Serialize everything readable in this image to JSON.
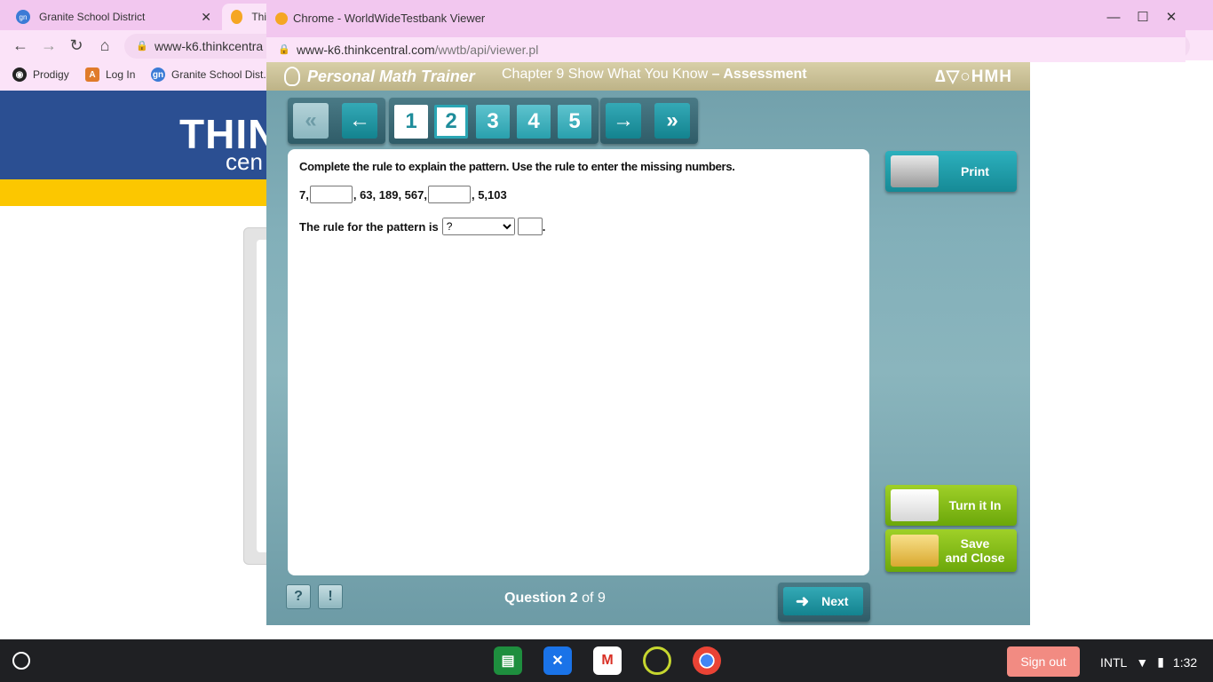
{
  "browser": {
    "tabs": [
      {
        "label": "Granite School District",
        "active": false
      },
      {
        "label": "Thi",
        "active": true
      }
    ],
    "url": "www-k6.thinkcentra",
    "bookmarks": [
      "Prodigy",
      "Log In",
      "Granite School Dist..."
    ],
    "banner_logo_line1": "THIN",
    "banner_logo_line2": "cen"
  },
  "popup": {
    "title": "Chrome - WorldWideTestbank Viewer",
    "url_host": "www-k6.thinkcentral.com",
    "url_path": "/wwtb/api/viewer.pl",
    "buttons": {
      "minimize": "—",
      "maximize": "☐",
      "close": "✕"
    }
  },
  "trainer": {
    "brand": "Personal Math Trainer",
    "chapter_title": "Chapter 9 Show What You Know",
    "chapter_suffix": "– Assessment",
    "publisher": "∆▽○HMH",
    "nav": {
      "first": "«",
      "prev": "←",
      "next": "→",
      "last": "»",
      "questions": [
        "1",
        "2",
        "3",
        "4",
        "5"
      ],
      "current_question": 2
    },
    "question": {
      "instruction": "Complete the rule to explain the pattern. Use the rule to enter the missing numbers.",
      "sequence": [
        "7,",
        ", 63, 189, 567,",
        ", 5,103"
      ],
      "rule_prefix": "The rule for the pattern is",
      "rule_select_value": "?",
      "rule_suffix": "."
    },
    "side_buttons": {
      "print": "Print",
      "turn_in": "Turn it In",
      "save_close_line1": "Save",
      "save_close_line2": "and Close"
    },
    "footer": {
      "help_icon": "?",
      "alert_icon": "!",
      "question_label": "Question",
      "question_current": "2",
      "question_of": "of 9",
      "next_label": "Next"
    }
  },
  "shelf": {
    "sign_out": "Sign out",
    "keyboard": "INTL",
    "time": "1:32"
  }
}
